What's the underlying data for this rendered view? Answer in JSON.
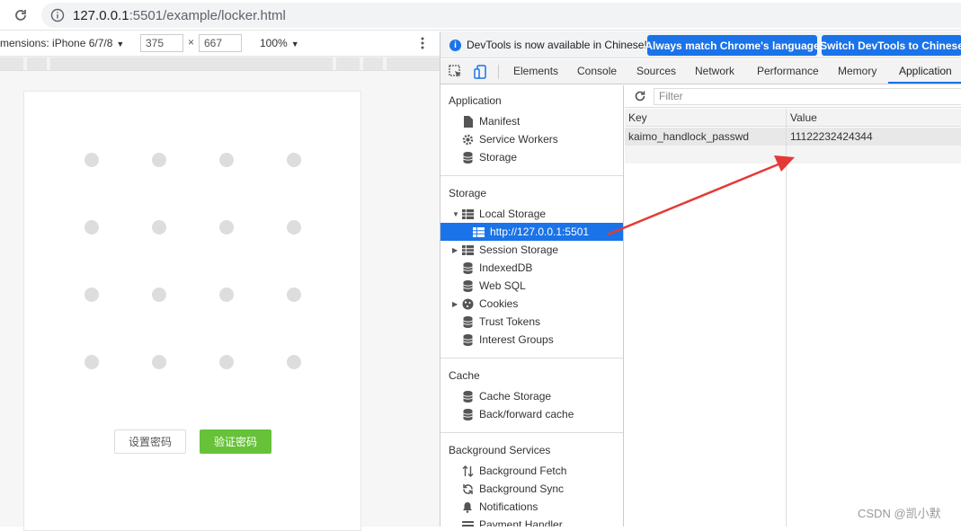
{
  "browser": {
    "url_host": "127.0.0.1",
    "url_rest": ":5501/example/locker.html"
  },
  "device_toolbar": {
    "device": "mensions: iPhone 6/7/8",
    "width": "375",
    "times": "×",
    "height": "667",
    "zoom": "100%"
  },
  "page": {
    "set_button": "设置密码",
    "verify_button": "验证密码",
    "accent_color": "#67c23a"
  },
  "devtools": {
    "info_message": "DevTools is now available in Chinese!",
    "match_button": "Always match Chrome's language",
    "switch_button": "Switch DevTools to Chinese",
    "tabs": [
      "Elements",
      "Console",
      "Sources",
      "Network",
      "Performance",
      "Memory",
      "Application"
    ],
    "active_tab": "Application",
    "sidebar": {
      "application_title": "Application",
      "application_items": [
        "Manifest",
        "Service Workers",
        "Storage"
      ],
      "storage_title": "Storage",
      "storage_items": [
        "Local Storage",
        "http://127.0.0.1:5501",
        "Session Storage",
        "IndexedDB",
        "Web SQL",
        "Cookies",
        "Trust Tokens",
        "Interest Groups"
      ],
      "cache_title": "Cache",
      "cache_items": [
        "Cache Storage",
        "Back/forward cache"
      ],
      "bg_title": "Background Services",
      "bg_items": [
        "Background Fetch",
        "Background Sync",
        "Notifications",
        "Payment Handler"
      ]
    },
    "filter_placeholder": "Filter",
    "table": {
      "key_header": "Key",
      "value_header": "Value",
      "rows": [
        {
          "key": "kaimo_handlock_passwd",
          "value": "11122232424344"
        }
      ]
    }
  },
  "watermark": "CSDN @凯小默",
  "annotation_color": "#e53935"
}
